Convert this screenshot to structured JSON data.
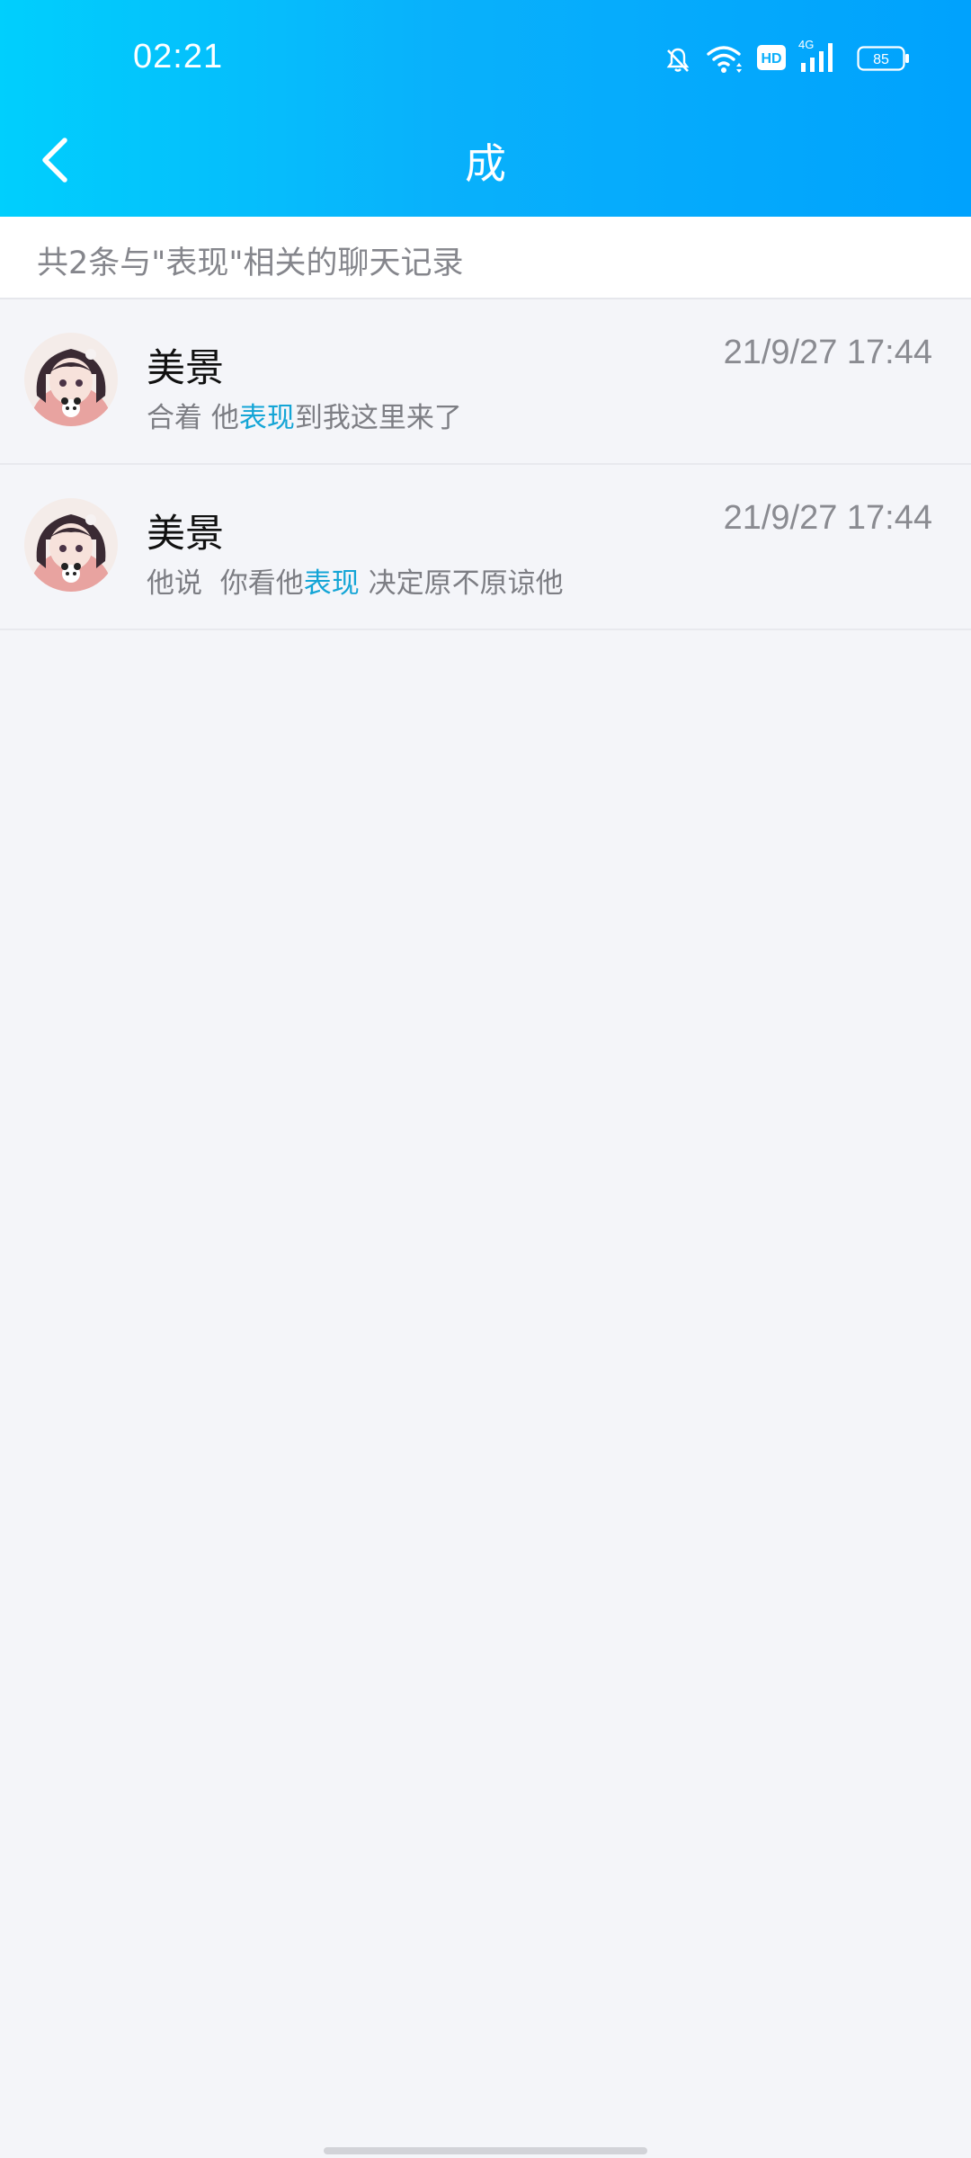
{
  "status_bar": {
    "time": "02:21",
    "icons": [
      "bell-muted-icon",
      "wifi-icon",
      "hd-icon",
      "signal-4g-icon",
      "battery-icon"
    ],
    "hd_label": "HD",
    "network_label": "4G",
    "battery_level": "85"
  },
  "nav": {
    "back_icon": "chevron-left-icon",
    "title": "成"
  },
  "summary": {
    "text": "共2条与\"表现\"相关的聊天记录"
  },
  "colors": {
    "header_gradient_start": "#00cffd",
    "header_gradient_end": "#00a2fd",
    "highlight": "#14a5d6",
    "background": "#f4f5f9"
  },
  "results": [
    {
      "name": "美景",
      "time": "21/9/27 17:44",
      "message_before": "合着 他",
      "message_highlight": "表现",
      "message_after": "到我这里来了"
    },
    {
      "name": "美景",
      "time": "21/9/27 17:44",
      "message_before": "他说  你看他",
      "message_highlight": "表现",
      "message_after": " 决定原不原谅他"
    }
  ]
}
